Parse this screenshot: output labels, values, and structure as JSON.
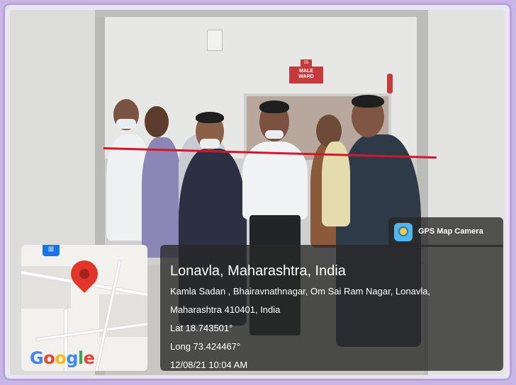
{
  "photo": {
    "sign": {
      "number": "05",
      "text": "MALE\nWARD"
    }
  },
  "gps_badge": {
    "icon": "gps-map-camera-icon",
    "label": "GPS Map Camera"
  },
  "location": {
    "title": "Lonavla, Maharashtra, India",
    "address_line1": "Kamla Sadan , Bhairavnathnagar, Om Sai Ram Nagar, Lonavla,",
    "address_line2": "Maharashtra 410401, India",
    "lat": "Lat 18.743501°",
    "long": "Long 73.424467°",
    "datetime": "12/08/21 10:04 AM"
  },
  "map": {
    "pin_icon": "map-pin-icon",
    "logo": "Google",
    "logo_colors": [
      "#4285F4",
      "#EA4335",
      "#FBBC05",
      "#4285F4",
      "#34A853",
      "#EA4335"
    ]
  }
}
